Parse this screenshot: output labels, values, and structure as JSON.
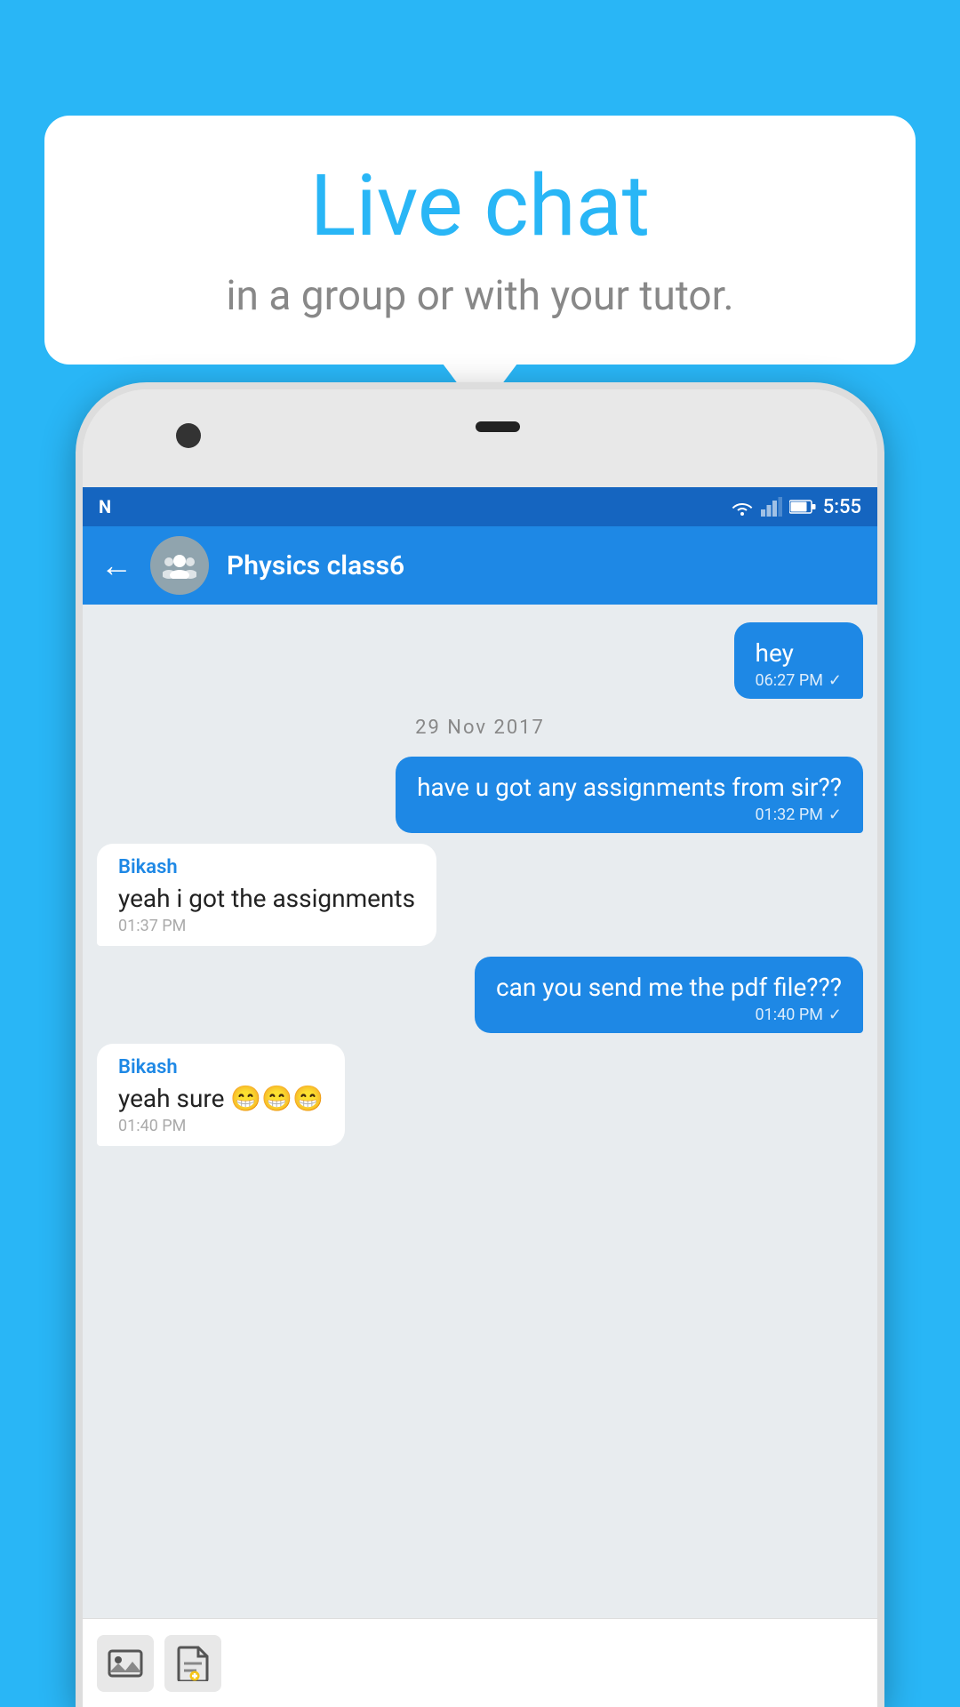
{
  "background_color": "#29b6f6",
  "speech_bubble": {
    "title": "Live chat",
    "subtitle": "in a group or with your tutor."
  },
  "phone": {
    "status_bar": {
      "time": "5:55",
      "network_icon": "N",
      "wifi": true,
      "battery": true
    },
    "app_bar": {
      "title": "Physics class6",
      "back_label": "←"
    },
    "messages": [
      {
        "type": "sent",
        "text": "hey",
        "time": "06:27 PM",
        "read": true
      },
      {
        "type": "date",
        "text": "29  Nov  2017"
      },
      {
        "type": "sent",
        "text": "have u got any assignments from sir??",
        "time": "01:32 PM",
        "read": true
      },
      {
        "type": "received",
        "sender": "Bikash",
        "text": "yeah i got the assignments",
        "time": "01:37 PM"
      },
      {
        "type": "sent",
        "text": "can you send me the pdf file???",
        "time": "01:40 PM",
        "read": true
      },
      {
        "type": "received",
        "sender": "Bikash",
        "text": "yeah sure 😁😁😁",
        "time": "01:40 PM"
      }
    ],
    "bottom_bar": {
      "attach_image_label": "🖼",
      "attach_file_label": "📄"
    }
  }
}
